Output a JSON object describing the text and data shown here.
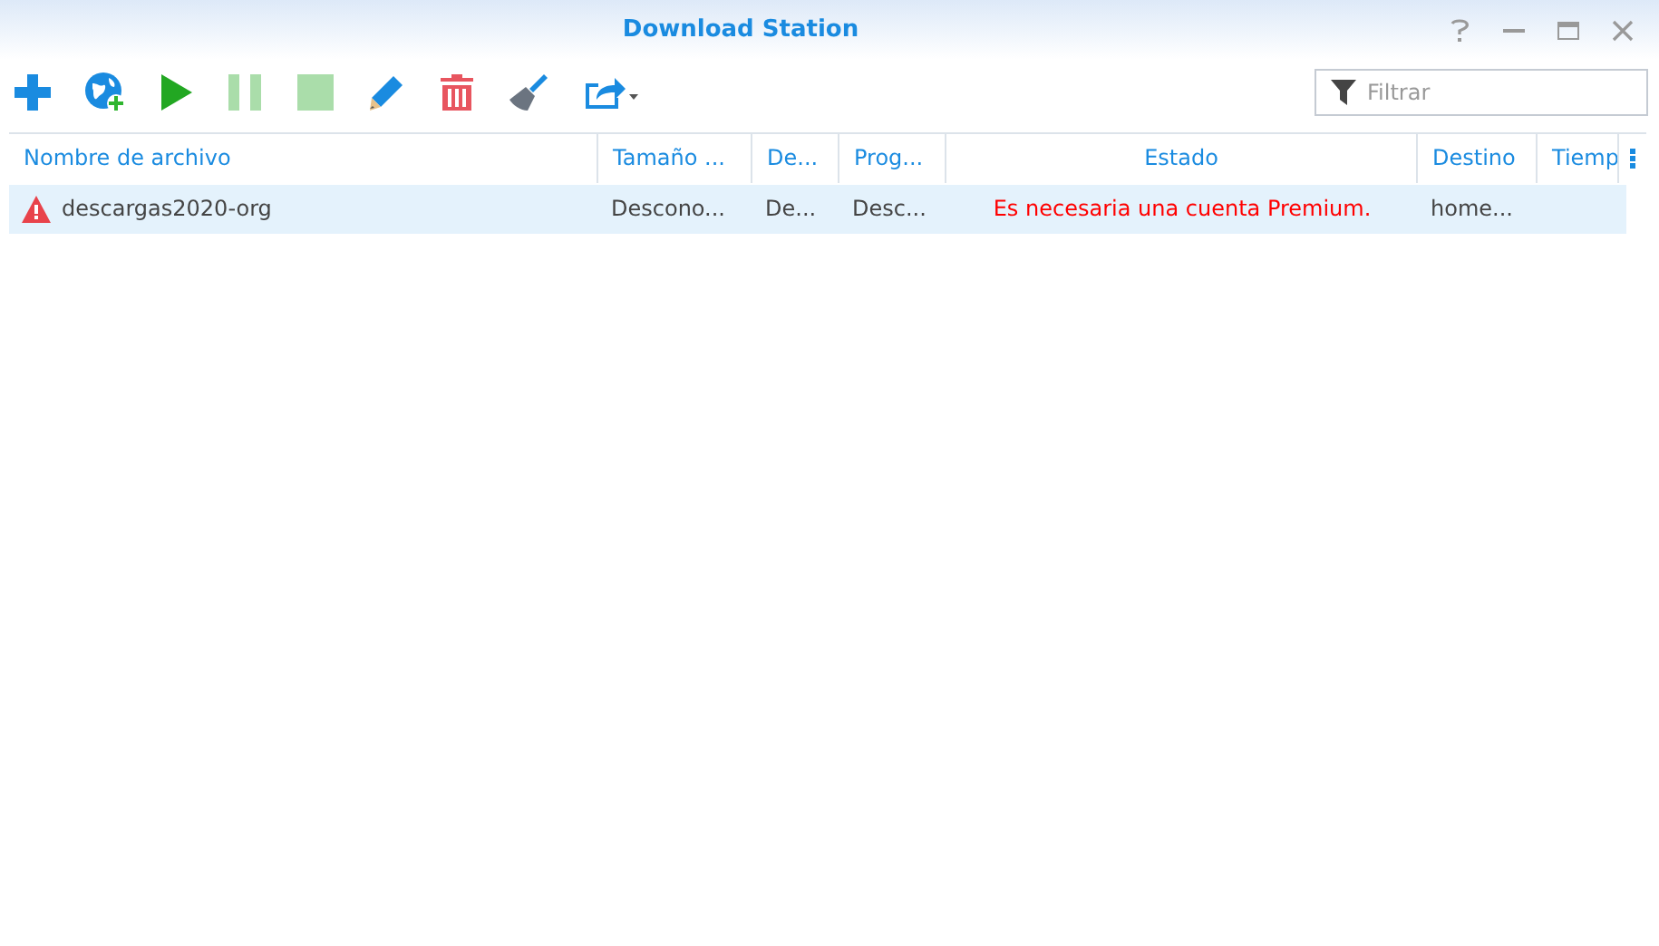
{
  "window": {
    "title": "Download Station"
  },
  "toolbar": [
    {
      "kind": "add",
      "disabled": false
    },
    {
      "kind": "add-url",
      "disabled": false
    },
    {
      "kind": "play",
      "disabled": false
    },
    {
      "kind": "pause",
      "disabled": true
    },
    {
      "kind": "stop",
      "disabled": true
    },
    {
      "kind": "edit",
      "disabled": false
    },
    {
      "kind": "delete",
      "disabled": false
    },
    {
      "kind": "clean",
      "disabled": false
    },
    {
      "kind": "share",
      "disabled": false
    }
  ],
  "search": {
    "placeholder": "Filtrar"
  },
  "table": {
    "columns": [
      {
        "label": "Nombre de archivo"
      },
      {
        "label": "Tamaño ..."
      },
      {
        "label": "De..."
      },
      {
        "label": "Prog..."
      },
      {
        "label": "Estado"
      },
      {
        "label": "Destino"
      },
      {
        "label": "Tiemp"
      }
    ],
    "rows": [
      {
        "selected": true,
        "error": true,
        "cells": [
          "descargas2020-org",
          "Descono...",
          "De...",
          "Desc...",
          "Es necesaria una cuenta Premium.",
          "home...",
          ""
        ]
      }
    ]
  }
}
